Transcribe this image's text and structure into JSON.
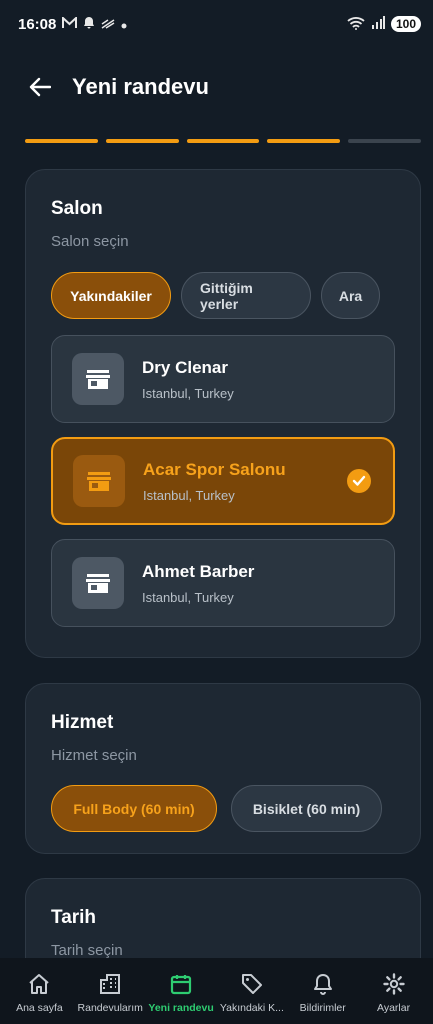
{
  "status_bar": {
    "time": "16:08",
    "icons": [
      "mail-icon",
      "bell-icon",
      "signal-off-icon",
      "dot-icon"
    ],
    "battery": "100"
  },
  "header": {
    "title": "Yeni randevu"
  },
  "progress": {
    "total_steps": 5,
    "completed_steps": 4
  },
  "salon_section": {
    "title": "Salon",
    "subtitle": "Salon seçin",
    "filters": [
      {
        "label": "Yakındakiler",
        "active": true
      },
      {
        "label": "Gittiğim yerler",
        "active": false
      },
      {
        "label": "Ara",
        "active": false
      }
    ],
    "salons": [
      {
        "name": "Dry Clenar",
        "location": "Istanbul, Turkey",
        "selected": false
      },
      {
        "name": "Acar Spor Salonu",
        "location": "Istanbul, Turkey",
        "selected": true
      },
      {
        "name": "Ahmet Barber",
        "location": "Istanbul, Turkey",
        "selected": false
      }
    ]
  },
  "service_section": {
    "title": "Hizmet",
    "subtitle": "Hizmet seçin",
    "options": [
      {
        "label": "Full Body (60 min)",
        "active": true
      },
      {
        "label": "Bisiklet (60 min)",
        "active": false
      }
    ]
  },
  "date_section": {
    "title": "Tarih",
    "subtitle": "Tarih seçin"
  },
  "bottom_nav": [
    {
      "label": "Ana sayfa",
      "icon": "home-icon",
      "active": false
    },
    {
      "label": "Randevularım",
      "icon": "building-icon",
      "active": false
    },
    {
      "label": "Yeni randevu",
      "icon": "calendar-icon",
      "active": true
    },
    {
      "label": "Yakındaki K...",
      "icon": "tag-icon",
      "active": false
    },
    {
      "label": "Bildirimler",
      "icon": "bell-icon",
      "active": false
    },
    {
      "label": "Ayarlar",
      "icon": "gear-icon",
      "active": false
    }
  ],
  "colors": {
    "accent": "#f39c12",
    "active_nav": "#2ecc71",
    "background": "#131c26",
    "card": "#1e2833"
  }
}
